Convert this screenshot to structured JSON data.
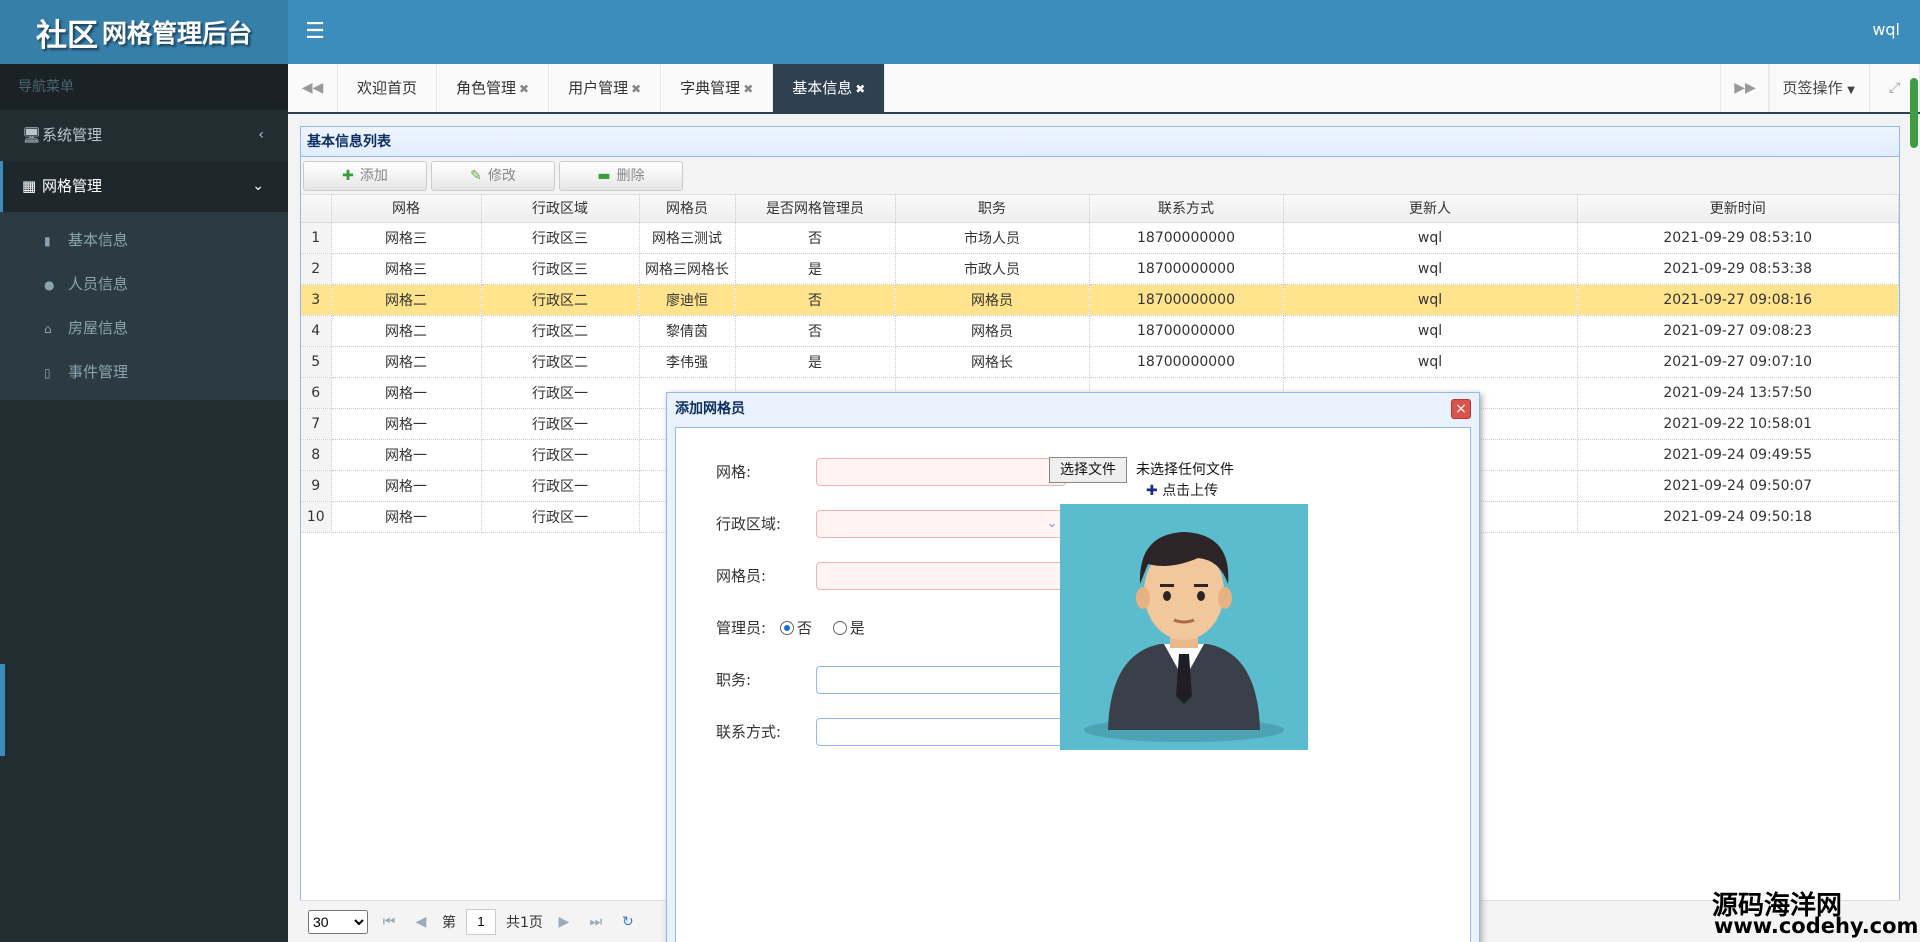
{
  "app": {
    "title_big": "社区",
    "title_small": "网格管理后台",
    "user": "wql"
  },
  "sidebar": {
    "header": "导航菜单",
    "items": [
      {
        "label": "系统管理",
        "icon": "monitor-icon"
      },
      {
        "label": "网格管理",
        "icon": "grid-icon"
      }
    ],
    "sub_items": [
      {
        "label": "基本信息",
        "icon": "book-icon"
      },
      {
        "label": "人员信息",
        "icon": "user-icon"
      },
      {
        "label": "房屋信息",
        "icon": "home-icon"
      },
      {
        "label": "事件管理",
        "icon": "file-icon"
      }
    ]
  },
  "tabs": [
    {
      "label": "欢迎首页",
      "closable": false
    },
    {
      "label": "角色管理",
      "closable": true
    },
    {
      "label": "用户管理",
      "closable": true
    },
    {
      "label": "字典管理",
      "closable": true
    },
    {
      "label": "基本信息",
      "closable": true,
      "active": true
    }
  ],
  "tab_ops": "页签操作",
  "panel": {
    "title": "基本信息列表"
  },
  "toolbar": {
    "add": "添加",
    "edit": "修改",
    "delete": "删除"
  },
  "table": {
    "columns": [
      "网格",
      "行政区域",
      "网格员",
      "是否网格管理员",
      "职务",
      "联系方式",
      "更新人",
      "更新时间"
    ],
    "rows": [
      [
        "1",
        "网格三",
        "行政区三",
        "网格三测试",
        "否",
        "市场人员",
        "18700000000",
        "wql",
        "2021-09-29 08:53:10"
      ],
      [
        "2",
        "网格三",
        "行政区三",
        "网格三网格长",
        "是",
        "市政人员",
        "18700000000",
        "wql",
        "2021-09-29 08:53:38"
      ],
      [
        "3",
        "网格二",
        "行政区二",
        "廖迪恒",
        "否",
        "网格员",
        "18700000000",
        "wql",
        "2021-09-27 09:08:16"
      ],
      [
        "4",
        "网格二",
        "行政区二",
        "黎倩茵",
        "否",
        "网格员",
        "18700000000",
        "wql",
        "2021-09-27 09:08:23"
      ],
      [
        "5",
        "网格二",
        "行政区二",
        "李伟强",
        "是",
        "网格长",
        "18700000000",
        "wql",
        "2021-09-27 09:07:10"
      ],
      [
        "6",
        "网格一",
        "行政区一",
        "",
        "",
        "",
        "",
        "",
        "2021-09-24 13:57:50"
      ],
      [
        "7",
        "网格一",
        "行政区一",
        "",
        "",
        "",
        "",
        "",
        "2021-09-22 10:58:01"
      ],
      [
        "8",
        "网格一",
        "行政区一",
        "网",
        "",
        "",
        "",
        "",
        "2021-09-24 09:49:55"
      ],
      [
        "9",
        "网格一",
        "行政区一",
        "网",
        "",
        "",
        "",
        "",
        "2021-09-24 09:50:07"
      ],
      [
        "10",
        "网格一",
        "行政区一",
        "网",
        "",
        "",
        "",
        "",
        "2021-09-24 09:50:18"
      ]
    ],
    "selected_row": 3
  },
  "pager": {
    "page_size": "30",
    "page_label_pre": "第",
    "page": "1",
    "page_label_post": "共1页"
  },
  "dialog": {
    "title": "添加网格员",
    "close": "×",
    "labels": {
      "grid": "网格:",
      "region": "行政区域:",
      "member": "网格员:",
      "manager": "管理员:",
      "position": "职务:",
      "contact": "联系方式:"
    },
    "manager_no": "否",
    "manager_yes": "是",
    "file_button": "选择文件",
    "file_status": "未选择任何文件",
    "upload_label": "点击上传"
  },
  "watermark": {
    "line1": "源码海洋网",
    "line2": "www.codehy.com"
  },
  "colors": {
    "header": "#3c8dbc",
    "sidebar": "#222d32",
    "selected_row": "#ffe48d"
  }
}
